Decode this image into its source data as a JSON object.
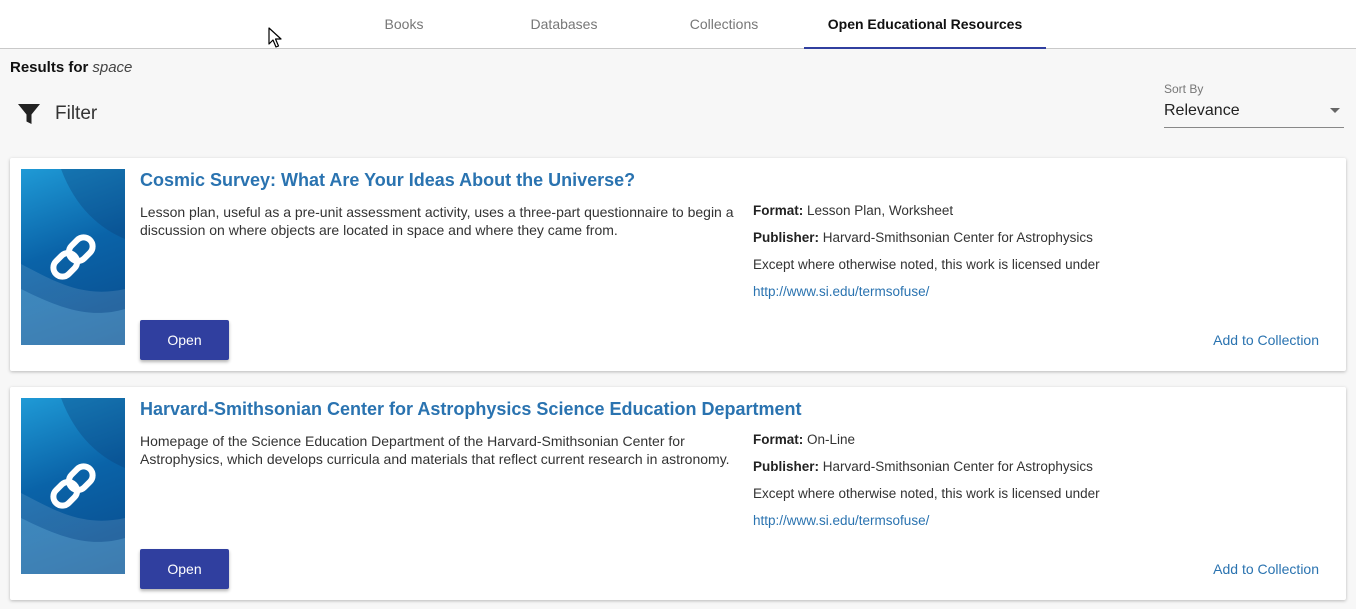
{
  "tabs": [
    {
      "label": "Books"
    },
    {
      "label": "Databases"
    },
    {
      "label": "Collections"
    },
    {
      "label": "Open Educational Resources"
    }
  ],
  "active_tab": "Open Educational Resources",
  "results": {
    "label": "Results for",
    "query": "space"
  },
  "filter": {
    "label": "Filter",
    "icon": "filter-icon"
  },
  "sort": {
    "caption": "Sort By",
    "value": "Relevance"
  },
  "colors": {
    "accent": "#303f9f",
    "link": "#2a73b0"
  },
  "cards": [
    {
      "title": "Cosmic Survey: What Are Your Ideas About the Universe?",
      "description": "Lesson plan, useful as a pre-unit assessment activity, uses a three-part questionnaire to begin a discussion on where objects are located in space and where they came from.",
      "format_label": "Format:",
      "format": "Lesson Plan, Worksheet",
      "publisher_label": "Publisher:",
      "publisher": "Harvard-Smithsonian Center for Astrophysics",
      "license": "Except where otherwise noted, this work is licensed under",
      "license_url": "http://www.si.edu/termsofuse/",
      "open_label": "Open",
      "add_label": "Add to Collection",
      "thumb_icon": "link-icon"
    },
    {
      "title": "Harvard-Smithsonian Center for Astrophysics Science Education Department",
      "description": "Homepage of the Science Education Department of the Harvard-Smithsonian Center for Astrophysics, which develops curricula and materials that reflect current research in astronomy.",
      "format_label": "Format:",
      "format": "On-Line",
      "publisher_label": "Publisher:",
      "publisher": "Harvard-Smithsonian Center for Astrophysics",
      "license": "Except where otherwise noted, this work is licensed under",
      "license_url": "http://www.si.edu/termsofuse/",
      "open_label": "Open",
      "add_label": "Add to Collection",
      "thumb_icon": "link-icon"
    }
  ]
}
